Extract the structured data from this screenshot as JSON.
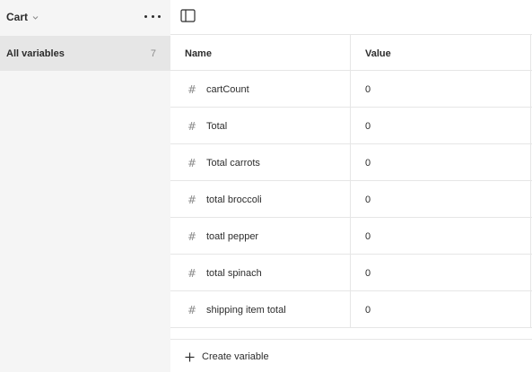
{
  "sidebar": {
    "collection_name": "Cart",
    "groups": [
      {
        "label": "All variables",
        "count": "7"
      }
    ]
  },
  "table": {
    "columns": [
      "Name",
      "Value"
    ],
    "rows": [
      {
        "name": "cartCount",
        "value": "0"
      },
      {
        "name": "Total",
        "value": "0"
      },
      {
        "name": "Total carrots",
        "value": "0"
      },
      {
        "name": "total broccoli",
        "value": "0"
      },
      {
        "name": "toatl pepper",
        "value": "0"
      },
      {
        "name": "total spinach",
        "value": "0"
      },
      {
        "name": "shipping item total",
        "value": "0"
      }
    ],
    "type_icon": "#"
  },
  "footer": {
    "create_label": "Create variable"
  },
  "icons": {
    "collection_dropdown": "chevron-down-icon",
    "more": "more-horizontal-icon",
    "toggle_sidebar": "sidebar-toggle-icon",
    "variable_type": "number-hash-icon",
    "create": "plus-icon"
  },
  "colors": {
    "sidebar_bg": "#f5f5f5",
    "selected_group_bg": "#e6e6e6",
    "border": "#e6e6e6",
    "text": "#2c2c2c",
    "muted": "#8c8c8c"
  }
}
